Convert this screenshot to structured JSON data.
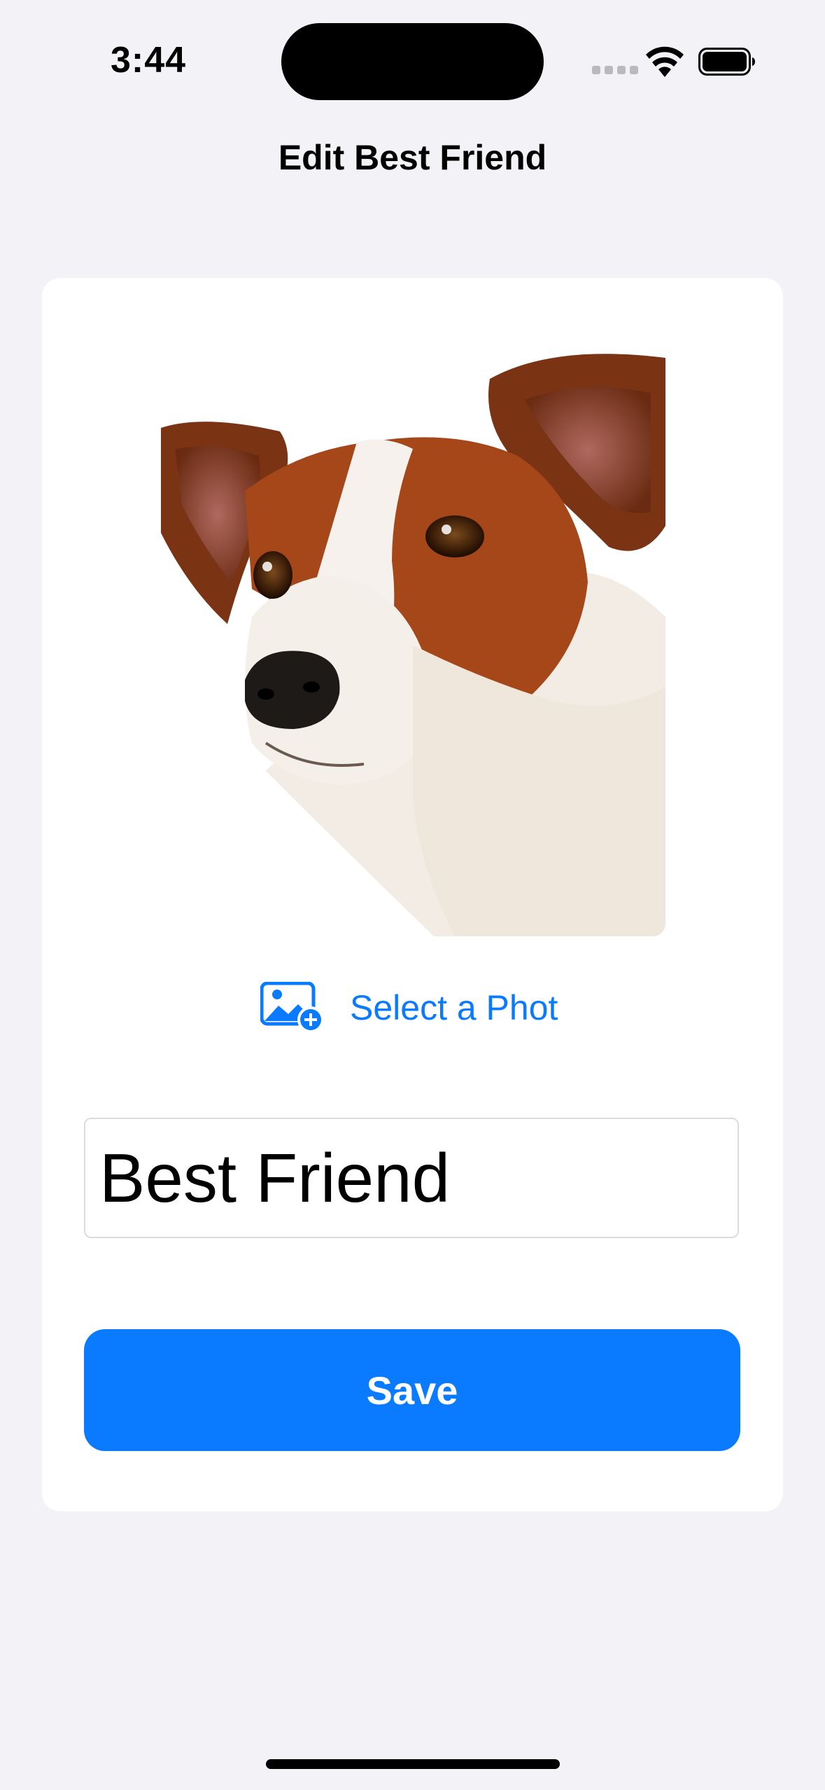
{
  "status_bar": {
    "time": "3:44"
  },
  "nav": {
    "title": "Edit Best Friend"
  },
  "photo": {
    "description_icon": "dog-photo"
  },
  "select_photo": {
    "label": "Select a Phot",
    "icon": "photo-badge-plus-icon"
  },
  "name_field": {
    "value": "Best Friend"
  },
  "save_button": {
    "label": "Save"
  },
  "colors": {
    "accent": "#0a7aff",
    "background": "#f2f2f7",
    "card": "#ffffff"
  }
}
